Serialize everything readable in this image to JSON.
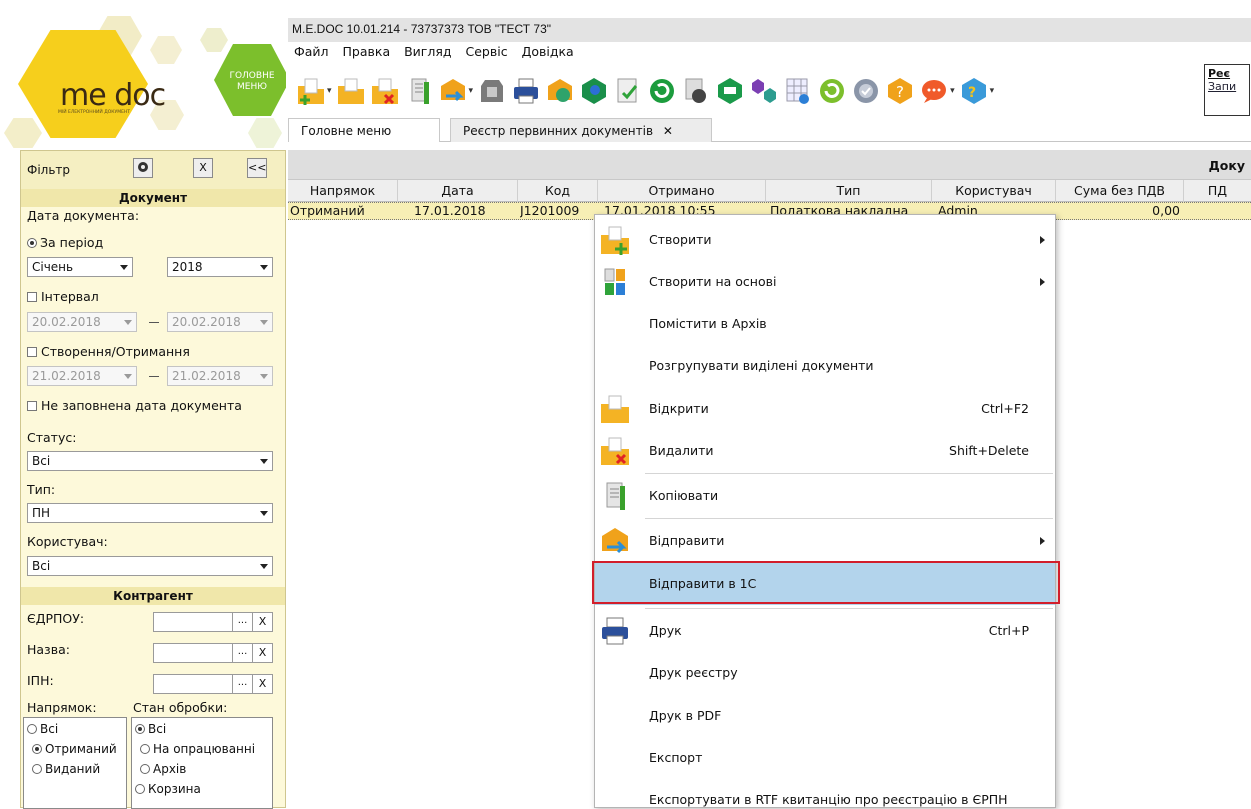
{
  "app": {
    "window_title": "M.E.DOC 10.01.214 - 73737373 ТОВ \"ТЕСТ 73\"",
    "logo": {
      "brand": "me doc",
      "subtitle": "МІЙ ЕЛЕКТРОННИЙ ДОКУМЕНТ"
    },
    "home_button": {
      "line1": "ГОЛОВНЕ",
      "line2": "МЕНЮ"
    }
  },
  "menu": [
    "Файл",
    "Правка",
    "Вигляд",
    "Сервіс",
    "Довідка"
  ],
  "toolbar": {
    "icons": [
      "create-icon",
      "open-icon",
      "delete-icon",
      "copy-icon",
      "send-icon",
      "receipt-icon",
      "print-icon",
      "sign-icon",
      "validate-icon",
      "check-icon",
      "refresh-icon",
      "calculator-icon",
      "box-icon",
      "flow-icon",
      "grid-icon",
      "update-icon",
      "archive-icon",
      "help-icon",
      "chat-icon",
      "info-icon"
    ],
    "side_label": {
      "line1": "Реє",
      "line2": "Запи"
    }
  },
  "tabs": [
    {
      "label": "Головне меню"
    },
    {
      "label": "Реєстр первинних документів",
      "close": "✕"
    }
  ],
  "filter": {
    "label": "Фільтр",
    "buttons": {
      "clear": "X",
      "collapse": "<<"
    },
    "document_section": "Документ",
    "doc_date_label": "Дата документа:",
    "period_label": "За період",
    "month": "Січень",
    "year": "2018",
    "interval_label": "Інтервал",
    "interval_from": "20.02.2018",
    "interval_to": "20.02.2018",
    "created_label": "Створення/Отримання",
    "created_from": "21.02.2018",
    "created_to": "21.02.2018",
    "empty_date_label": "Не заповнена дата документа",
    "status_label": "Статус:",
    "status_value": "Всі",
    "type_label": "Тип:",
    "type_value": "ПН",
    "user_label": "Користувач:",
    "user_value": "Всі",
    "counterparty_section": "Контрагент",
    "edrpou_label": "ЄДРПОУ:",
    "name_label": "Назва:",
    "ipn_label": "ІПН:",
    "dots": "...",
    "x": "X",
    "direction_label": "Напрямок:",
    "processing_label": "Стан обробки:",
    "direction_options": [
      "Всі",
      "Отриманий",
      "Виданий"
    ],
    "processing_options": [
      "Всі",
      "На опрацюванні",
      "Архів",
      "Корзина"
    ]
  },
  "grid": {
    "top_label": "Доку",
    "columns": [
      "Напрямок",
      "Дата",
      "Код",
      "Отримано",
      "Тип",
      "Користувач",
      "Сума без ПДВ",
      "ПД"
    ],
    "rows": [
      [
        "Отриманий",
        "17.01.2018",
        "J1201009",
        "17.01.2018 10:55",
        "Податкова накладна",
        "Admin",
        "0,00",
        ""
      ]
    ]
  },
  "context_menu": {
    "items": [
      {
        "label": "Створити",
        "shortcut": "",
        "submenu": true,
        "icon": "create-icon"
      },
      {
        "label": "Створити на основі",
        "shortcut": "",
        "submenu": true,
        "icon": "create-based-icon"
      },
      {
        "label": "Помістити в Архів",
        "shortcut": "",
        "submenu": false,
        "icon": ""
      },
      {
        "label": "Розгрупувати виділені документи",
        "shortcut": "",
        "submenu": false,
        "icon": ""
      },
      {
        "label": "Відкрити",
        "shortcut": "Ctrl+F2",
        "submenu": false,
        "icon": "open-icon"
      },
      {
        "label": "Видалити",
        "shortcut": "Shift+Delete",
        "submenu": false,
        "icon": "delete-icon"
      },
      {
        "label": "Копіювати",
        "shortcut": "",
        "submenu": false,
        "icon": "copy-icon"
      },
      {
        "label": "Відправити",
        "shortcut": "",
        "submenu": true,
        "icon": "send-icon"
      },
      {
        "label": "Відправити в 1С",
        "shortcut": "",
        "submenu": false,
        "icon": "",
        "highlighted": true
      },
      {
        "label": "Друк",
        "shortcut": "Ctrl+P",
        "submenu": false,
        "icon": "print-icon"
      },
      {
        "label": "Друк реєстру",
        "shortcut": "",
        "submenu": false,
        "icon": ""
      },
      {
        "label": "Друк в PDF",
        "shortcut": "",
        "submenu": false,
        "icon": ""
      },
      {
        "label": "Експорт",
        "shortcut": "",
        "submenu": false,
        "icon": ""
      },
      {
        "label": "Експортувати в RTF квитанцію про реєстрацію в ЄРПН",
        "shortcut": "",
        "submenu": false,
        "icon": ""
      }
    ]
  },
  "colors": {
    "highlight": "#b3d4ec",
    "annotation": "#d21e2b",
    "panel": "#fdf9da",
    "selected_row": "#f7efb5"
  }
}
